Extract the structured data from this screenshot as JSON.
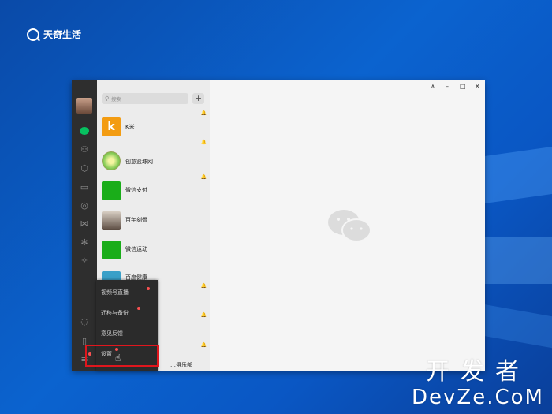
{
  "watermark_top": {
    "brand": "天奇生活"
  },
  "watermark_bottom": {
    "cn": "开发者",
    "en": "DevZe.CoM"
  },
  "window": {
    "controls": {
      "pin": "⊼",
      "minimize": "–",
      "maximize": "□",
      "close": "✕"
    }
  },
  "search": {
    "placeholder": "搜索",
    "add": "+"
  },
  "chats": [
    {
      "name": "K米",
      "color": "#f39c12"
    },
    {
      "name": "创意篮球网",
      "color": "#8bc34a"
    },
    {
      "name": "微信支付",
      "color": "#1aad19"
    },
    {
      "name": "百年刻骨",
      "color": "#b0a090"
    },
    {
      "name": "微信运动",
      "color": "#1aad19"
    },
    {
      "name": "百度健康",
      "color": "#3aa0c8"
    }
  ],
  "partial_items": {
    "item8": "…俱乐部"
  },
  "menu": {
    "items": [
      "视频号直播",
      "迁移与备份",
      "意见反馈",
      "设置"
    ]
  },
  "accent": {
    "wechat_green": "#07c160",
    "red_dot": "#fa5151",
    "highlight": "#e0161d"
  }
}
